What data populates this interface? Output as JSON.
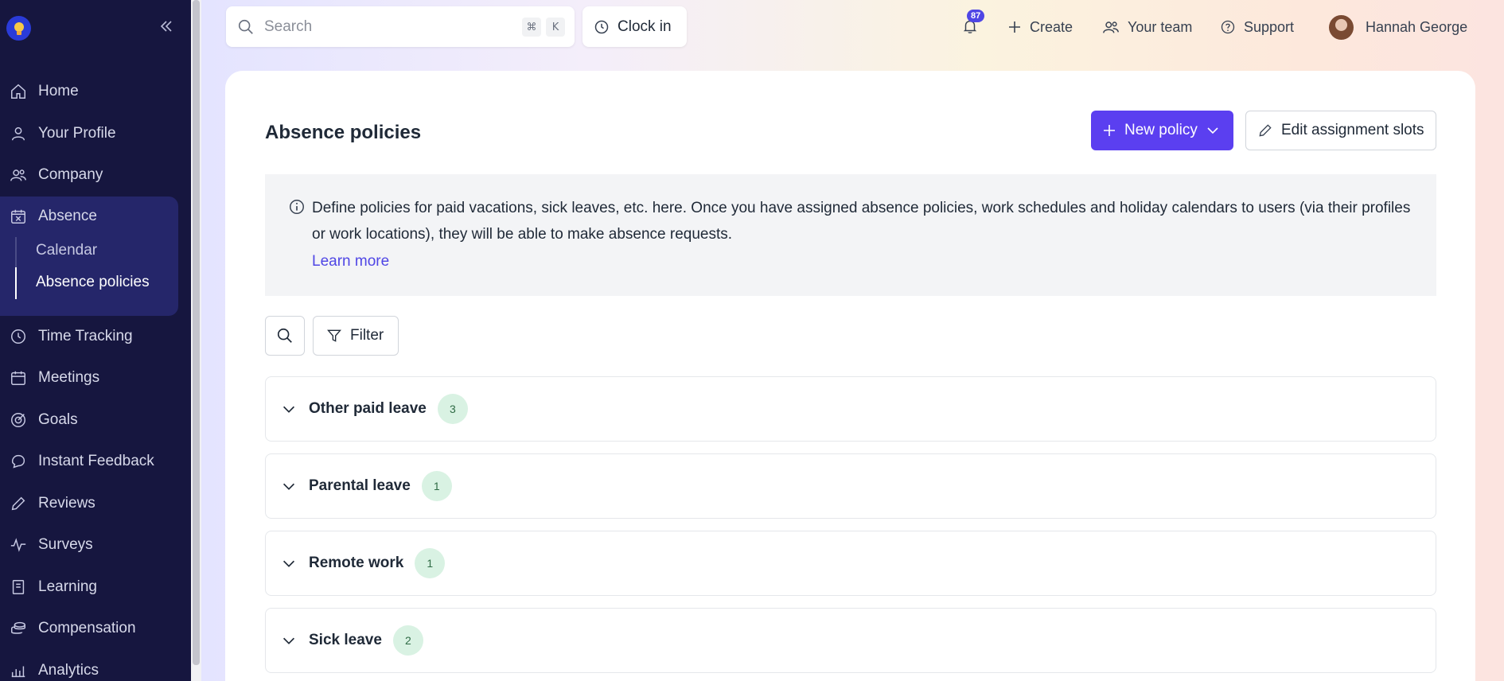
{
  "sidebar": {
    "items": [
      {
        "label": "Home",
        "icon": "home-icon"
      },
      {
        "label": "Your Profile",
        "icon": "user-icon"
      },
      {
        "label": "Company",
        "icon": "users-icon"
      },
      {
        "label": "Absence",
        "icon": "calendar-x-icon"
      },
      {
        "label": "Time Tracking",
        "icon": "clock-icon"
      },
      {
        "label": "Meetings",
        "icon": "calendar-icon"
      },
      {
        "label": "Goals",
        "icon": "target-icon"
      },
      {
        "label": "Instant Feedback",
        "icon": "chat-icon"
      },
      {
        "label": "Reviews",
        "icon": "pencil-icon"
      },
      {
        "label": "Surveys",
        "icon": "pulse-icon"
      },
      {
        "label": "Learning",
        "icon": "book-icon"
      },
      {
        "label": "Compensation",
        "icon": "coins-icon"
      },
      {
        "label": "Analytics",
        "icon": "chart-icon"
      }
    ],
    "absence_sub": [
      {
        "label": "Calendar"
      },
      {
        "label": "Absence policies"
      }
    ]
  },
  "topbar": {
    "search_placeholder": "Search",
    "kbd_cmd": "⌘",
    "kbd_k": "K",
    "clock_in": "Clock in",
    "notifications": "87",
    "create": "Create",
    "your_team": "Your team",
    "support": "Support",
    "user_name": "Hannah George"
  },
  "main": {
    "title": "Absence policies",
    "new_policy": "New policy",
    "edit_slots": "Edit assignment slots",
    "info_text": "Define policies for paid vacations, sick leaves, etc. here. Once you have assigned absence policies, work schedules and holiday calendars to users (via their profiles or work locations), they will be able to make absence requests.",
    "learn_more": "Learn more",
    "filter": "Filter",
    "groups": [
      {
        "label": "Other paid leave",
        "count": "3"
      },
      {
        "label": "Parental leave",
        "count": "1"
      },
      {
        "label": "Remote work",
        "count": "1"
      },
      {
        "label": "Sick leave",
        "count": "2"
      }
    ]
  },
  "colors": {
    "sidebar_bg": "#16163f",
    "accent": "#5b3ff0",
    "link": "#4f46e5",
    "badge_bg": "#d9f2e3"
  }
}
